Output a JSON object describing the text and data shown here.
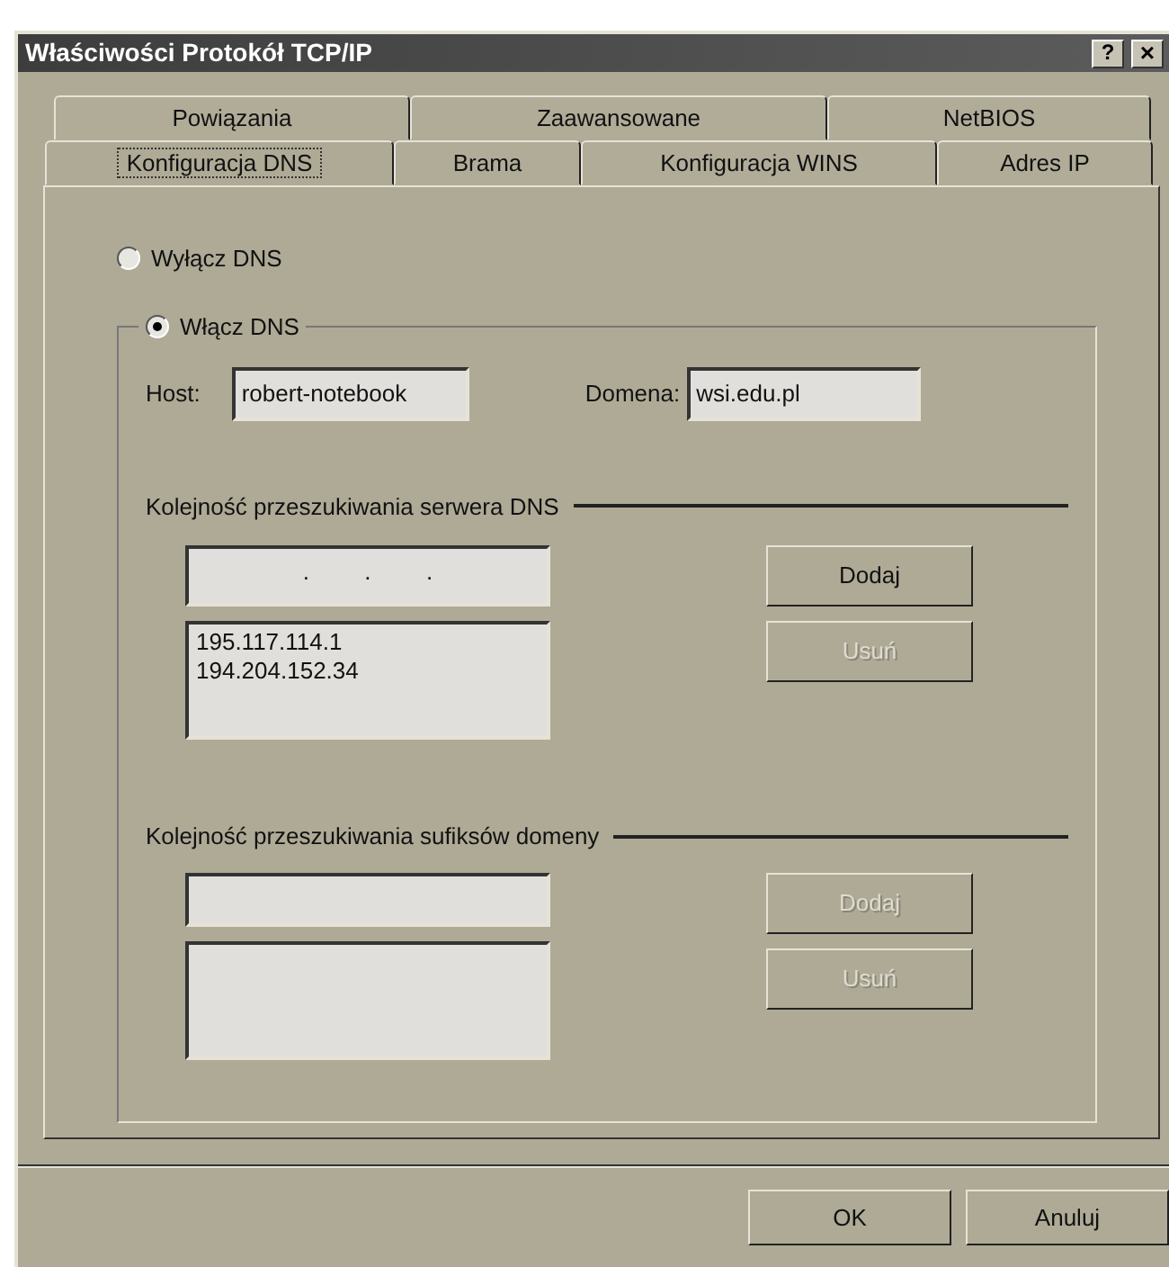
{
  "window": {
    "title": "Właściwości Protokół TCP/IP",
    "title_buttons": [
      {
        "kind": "help",
        "label": "?"
      },
      {
        "kind": "close",
        "label": "×"
      }
    ]
  },
  "tab_rows": [
    [
      {
        "label": "Powiązania",
        "selected": false
      },
      {
        "label": "Zaawansowane",
        "selected": false
      },
      {
        "label": "NetBIOS",
        "selected": false
      }
    ],
    [
      {
        "label": "Konfiguracja DNS",
        "selected": true
      },
      {
        "label": "Brama",
        "selected": false
      },
      {
        "label": "Konfiguracja WINS",
        "selected": false
      },
      {
        "label": "Adres IP",
        "selected": false
      }
    ]
  ],
  "dns_options": [
    {
      "label": "Wyłącz DNS",
      "selected": false
    },
    {
      "label": "Włącz DNS",
      "selected": true
    }
  ],
  "host": {
    "label": "Host:",
    "value": "robert-notebook"
  },
  "domain": {
    "label": "Domena:",
    "value": "wsi.edu.pl"
  },
  "sections": [
    {
      "heading": "Kolejność przeszukiwania serwera DNS",
      "kind": "ip",
      "dots": [
        ".",
        ".",
        "."
      ],
      "items": [
        "195.117.114.1",
        "194.204.152.34"
      ],
      "buttons": [
        {
          "label": "Dodaj",
          "disabled": false
        },
        {
          "label": "Usuń",
          "disabled": true
        }
      ]
    },
    {
      "heading": "Kolejność przeszukiwania sufiksów domeny",
      "kind": "text",
      "buttons": [
        {
          "label": "Dodaj",
          "disabled": true
        },
        {
          "label": "Usuń",
          "disabled": true
        }
      ]
    }
  ],
  "footer_buttons": [
    {
      "label": "OK"
    },
    {
      "label": "Anuluj"
    }
  ]
}
